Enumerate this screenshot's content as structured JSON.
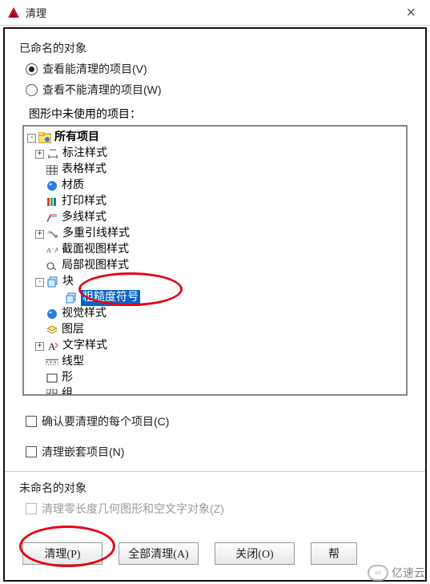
{
  "window": {
    "title": "清理"
  },
  "named": {
    "heading": "已命名的对象",
    "radio_view_purgeable": "查看能清理的项目(V)",
    "radio_view_nonpurgeable": "查看不能清理的项目(W)",
    "unused_label": "图形中未使用的项目："
  },
  "tree": {
    "root": "所有项目",
    "items": [
      "标注样式",
      "表格样式",
      "材质",
      "打印样式",
      "多线样式",
      "多重引线样式",
      "截面视图样式",
      "局部视图样式",
      "块",
      "粗糙度符号",
      "视觉样式",
      "图层",
      "文字样式",
      "线型",
      "形",
      "组"
    ]
  },
  "checks": {
    "confirm_each": "确认要清理的每个项目(C)",
    "nested": "清理嵌套项目(N)"
  },
  "unnamed": {
    "heading": "未命名的对象",
    "zero_len": "清理零长度几何图形和空文字对象(Z)"
  },
  "buttons": {
    "purge": "清理(P)",
    "purge_all": "全部清理(A)",
    "close": "关闭(O)",
    "help": "帮"
  },
  "watermark": "亿速云"
}
